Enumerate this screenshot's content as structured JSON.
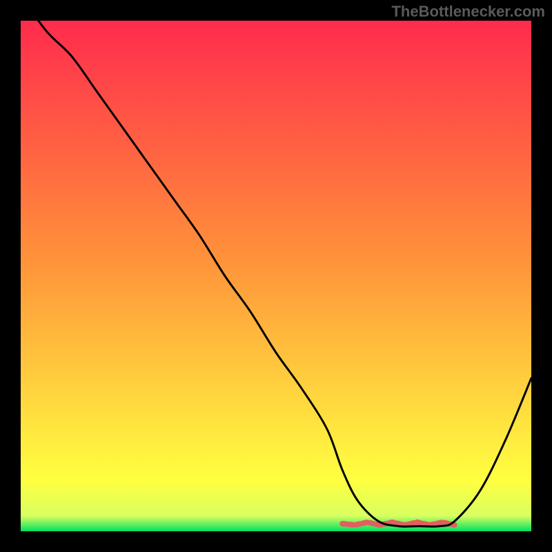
{
  "watermark": "TheBottlenecker.com",
  "gradient": {
    "top": "#ff2b4d",
    "mid1": "#ff8e3a",
    "mid2": "#ffff40",
    "bottom": "#00e060"
  },
  "chart_data": {
    "type": "line",
    "title": "",
    "xlabel": "",
    "ylabel": "",
    "xlim": [
      0,
      100
    ],
    "ylim": [
      0,
      100
    ],
    "x": [
      0,
      5,
      10,
      15,
      20,
      25,
      30,
      35,
      40,
      45,
      50,
      55,
      60,
      63,
      66,
      70,
      74,
      78,
      82,
      85,
      90,
      95,
      100
    ],
    "values": [
      105,
      98,
      93,
      86,
      79,
      72,
      65,
      58,
      50,
      43,
      35,
      28,
      20,
      12,
      6,
      2,
      1,
      1,
      1,
      2,
      8,
      18,
      30
    ],
    "flat_region": {
      "x_start": 63,
      "x_end": 85,
      "y": 1.5,
      "color": "#e06060",
      "thickness": 8
    },
    "curve_color": "#000000",
    "curve_thickness": 3,
    "grid": false,
    "legend": false
  }
}
